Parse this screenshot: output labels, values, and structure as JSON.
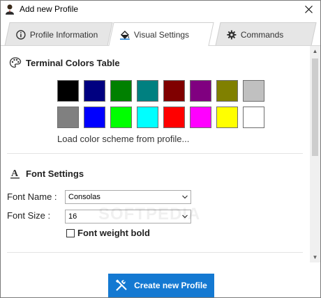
{
  "window": {
    "title": "Add new Profile"
  },
  "tabs": [
    {
      "label": "Profile Information",
      "icon": "info-icon"
    },
    {
      "label": "Visual Settings",
      "icon": "paint-bucket-icon"
    },
    {
      "label": "Commands",
      "icon": "gear-icon"
    }
  ],
  "active_tab": "Visual Settings",
  "terminal_colors": {
    "title": "Terminal Colors Table",
    "row1": [
      "#000000",
      "#000080",
      "#008000",
      "#008080",
      "#800000",
      "#800080",
      "#808000",
      "#c0c0c0"
    ],
    "row2": [
      "#808080",
      "#0000ff",
      "#00ff00",
      "#00ffff",
      "#ff0000",
      "#ff00ff",
      "#ffff00",
      "#ffffff"
    ],
    "load_scheme_label": "Load color scheme from profile..."
  },
  "font_settings": {
    "title": "Font Settings",
    "font_name_label": "Font Name :",
    "font_name_value": "Consolas",
    "font_size_label": "Font Size :",
    "font_size_value": "16",
    "bold_label": "Font weight bold",
    "bold_checked": false
  },
  "watermark": "SOFTPEDIA",
  "footer": {
    "create_label": "Create new Profile"
  },
  "colors": {
    "accent": "#1479d2"
  }
}
